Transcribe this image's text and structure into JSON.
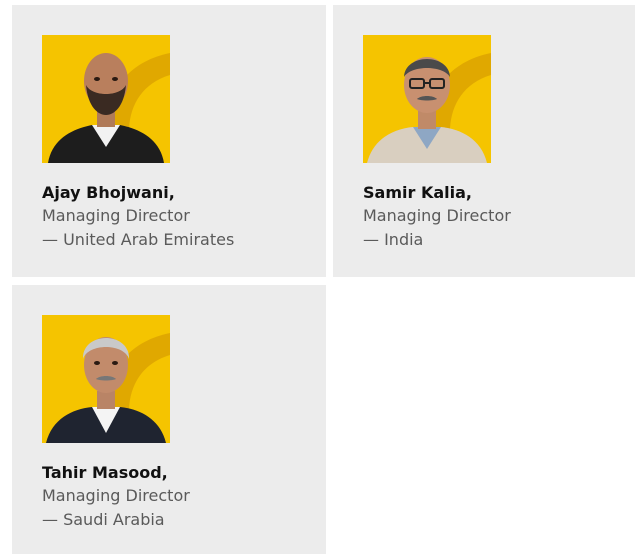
{
  "colors": {
    "card_background": "#ececec",
    "photo_background": "#f5c400",
    "photo_arc": "#e0a800",
    "name_text": "#111111",
    "detail_text": "#5a5a5a"
  },
  "team": [
    {
      "name": "Ajay Bhojwani,",
      "role": "Managing Director",
      "region": "— United Arab Emirates",
      "photo_icon": "person-portrait-icon"
    },
    {
      "name": "Samir Kalia,",
      "role": "Managing Director",
      "region": "— India",
      "photo_icon": "person-portrait-icon"
    },
    {
      "name": "Tahir Masood,",
      "role": "Managing Director",
      "region": "— Saudi Arabia",
      "photo_icon": "person-portrait-icon"
    }
  ]
}
